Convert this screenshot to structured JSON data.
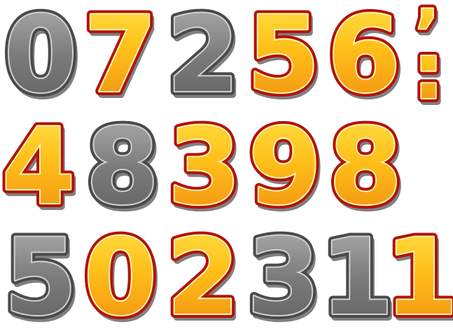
{
  "rows": [
    [
      {
        "char": "0",
        "style": "gray"
      },
      {
        "char": "7",
        "style": "gold"
      },
      {
        "char": "2",
        "style": "gray"
      },
      {
        "char": "5",
        "style": "gold"
      },
      {
        "char": "6",
        "style": "gold"
      },
      {
        "char": "’",
        "style": "gold"
      },
      {
        "char": ":",
        "style": "gold"
      }
    ],
    [
      {
        "char": "4",
        "style": "gold"
      },
      {
        "char": "8",
        "style": "gray"
      },
      {
        "char": "3",
        "style": "gold"
      },
      {
        "char": "9",
        "style": "gold"
      },
      {
        "char": "8",
        "style": "gold"
      }
    ],
    [
      {
        "char": "5",
        "style": "gray"
      },
      {
        "char": "0",
        "style": "gold"
      },
      {
        "char": "2",
        "style": "gold"
      },
      {
        "char": "3",
        "style": "gray"
      },
      {
        "char": "1",
        "style": "gray"
      },
      {
        "char": "1",
        "style": "gold"
      }
    ]
  ],
  "colors": {
    "gold_top": "#ffe44a",
    "gold_mid": "#ffbf18",
    "gold_bottom": "#f08a12",
    "gold_outline": "#b3120c",
    "gray_top": "#b4b4b4",
    "gray_mid": "#7b7b7b",
    "gray_bottom": "#5e5e5e",
    "gray_outline": "#4a4a4a",
    "shadow": "#1a1a1a"
  }
}
